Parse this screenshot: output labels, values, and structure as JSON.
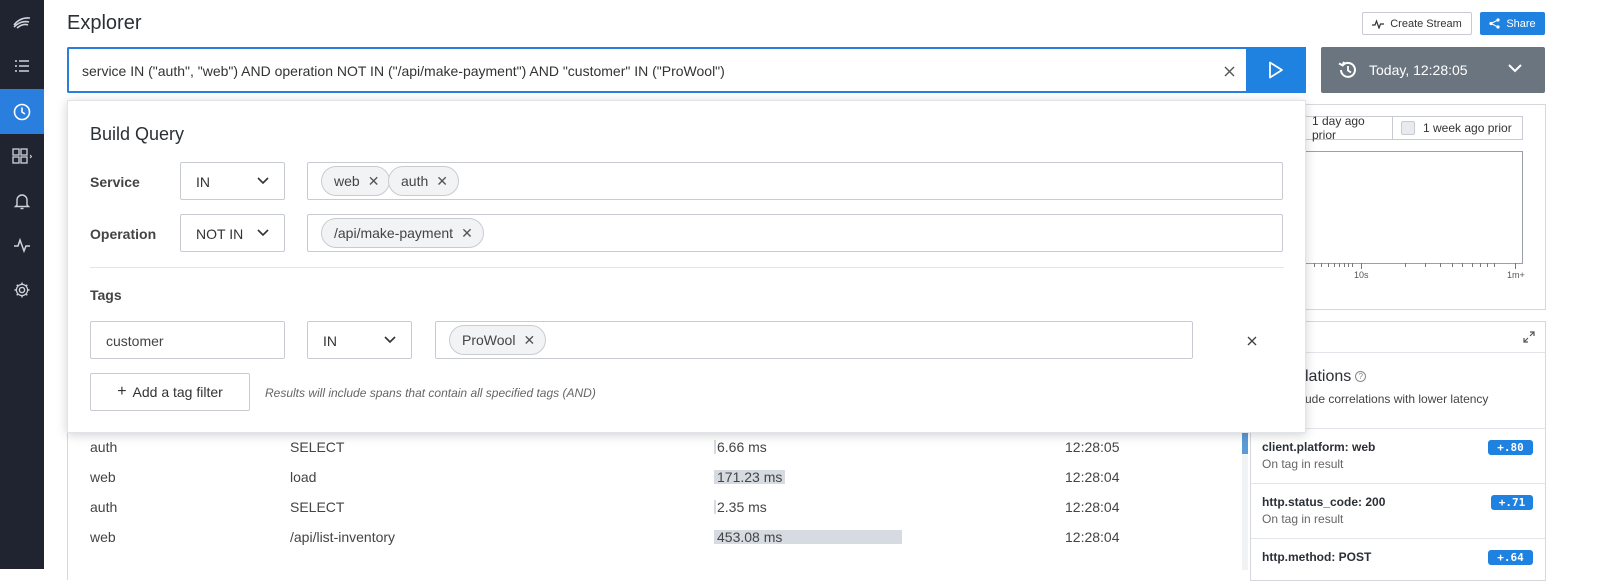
{
  "header": {
    "title": "Explorer",
    "create_stream_label": "Create Stream",
    "share_label": "Share"
  },
  "query": {
    "text": "service IN (\"auth\", \"web\") AND operation NOT IN (\"/api/make-payment\") AND \"customer\" IN (\"ProWool\")"
  },
  "time_picker": {
    "label": "Today, 12:28:05"
  },
  "compare": {
    "day_label": "1 day ago prior",
    "week_label": "1 week ago prior"
  },
  "histogram": {
    "axis_labels": [
      "10s",
      "1m+"
    ]
  },
  "build_query": {
    "title": "Build Query",
    "service": {
      "label": "Service",
      "operator": "IN",
      "values": [
        "web",
        "auth"
      ]
    },
    "operation": {
      "label": "Operation",
      "operator": "NOT IN",
      "values": [
        "/api/make-payment"
      ]
    },
    "tags": {
      "label": "Tags",
      "key": "customer",
      "operator": "IN",
      "values": [
        "ProWool"
      ]
    },
    "add_tag_label": "Add a tag filter",
    "hint": "Results will include spans that contain all specified tags (AND)"
  },
  "correlations": {
    "title_visible": "lations",
    "subtitle_visible": "ude correlations with lower latency",
    "items": [
      {
        "name": "client.platform: web",
        "desc": "On tag in result",
        "score": "+.80"
      },
      {
        "name": "http.status_code: 200",
        "desc": "On tag in result",
        "score": "+.71"
      },
      {
        "name": "http.method: POST",
        "desc": "",
        "score": "+.64"
      }
    ]
  },
  "results": {
    "rows": [
      {
        "service": "auth",
        "operation": "SELECT",
        "duration": "6.66 ms",
        "duration_fraction": 0.01,
        "time": "12:28:05"
      },
      {
        "service": "web",
        "operation": "load",
        "duration": "171.23 ms",
        "duration_fraction": 0.38,
        "time": "12:28:04"
      },
      {
        "service": "auth",
        "operation": "SELECT",
        "duration": "2.35 ms",
        "duration_fraction": 0.005,
        "time": "12:28:04"
      },
      {
        "service": "web",
        "operation": "/api/list-inventory",
        "duration": "453.08 ms",
        "duration_fraction": 1.0,
        "time": "12:28:04"
      }
    ]
  },
  "colors": {
    "sidebar_bg": "#1f2430",
    "accent": "#1f82e0",
    "time_picker_bg": "#6b7580"
  }
}
